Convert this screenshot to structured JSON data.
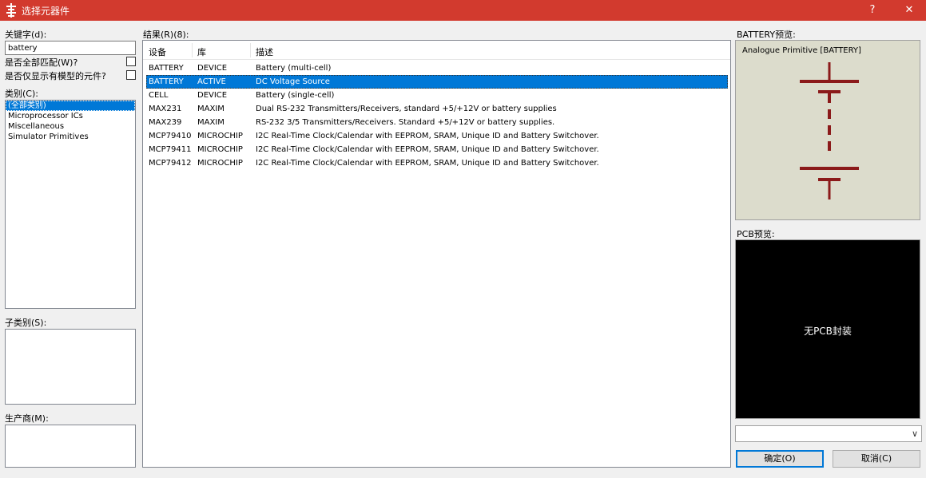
{
  "window": {
    "title": "选择元器件",
    "help": "?",
    "close": "✕"
  },
  "left": {
    "keyword_label": "关键字(d):",
    "keyword_value": "battery",
    "match_all_label": "是否全部匹配(W)?",
    "models_only_label": "是否仅显示有模型的元件?",
    "category_label": "类别(C):",
    "categories": [
      "(全部类别)",
      "Microprocessor ICs",
      "Miscellaneous",
      "Simulator Primitives"
    ],
    "subcategory_label": "子类别(S):",
    "manufacturer_label": "生产商(M):"
  },
  "results": {
    "label": "结果(R)(8):",
    "headers": [
      "设备",
      "库",
      "描述"
    ],
    "rows": [
      {
        "device": "BATTERY",
        "library": "DEVICE",
        "description": "Battery (multi-cell)"
      },
      {
        "device": "BATTERY",
        "library": "ACTIVE",
        "description": "DC Voltage Source"
      },
      {
        "device": "CELL",
        "library": "DEVICE",
        "description": "Battery (single-cell)"
      },
      {
        "device": "MAX231",
        "library": "MAXIM",
        "description": "Dual RS-232 Transmitters/Receivers, standard +5/+12V or battery supplies"
      },
      {
        "device": "MAX239",
        "library": "MAXIM",
        "description": "RS-232 3/5 Transmitters/Receivers. Standard +5/+12V or battery supplies."
      },
      {
        "device": "MCP79410",
        "library": "MICROCHIP",
        "description": "I2C Real-Time Clock/Calendar with EEPROM, SRAM, Unique ID and Battery Switchover."
      },
      {
        "device": "MCP79411",
        "library": "MICROCHIP",
        "description": "I2C Real-Time Clock/Calendar with EEPROM, SRAM, Unique ID and Battery Switchover."
      },
      {
        "device": "MCP79412",
        "library": "MICROCHIP",
        "description": "I2C Real-Time Clock/Calendar with EEPROM, SRAM, Unique ID and Battery Switchover."
      }
    ]
  },
  "preview": {
    "battery_label": "BATTERY预览:",
    "primitive_text": "Analogue Primitive [BATTERY]",
    "pcb_label": "PCB预览:",
    "pcb_text": "无PCB封装",
    "symbol_color": "#8b1a1a"
  },
  "buttons": {
    "ok": "确定(O)",
    "cancel": "取消(C)"
  }
}
